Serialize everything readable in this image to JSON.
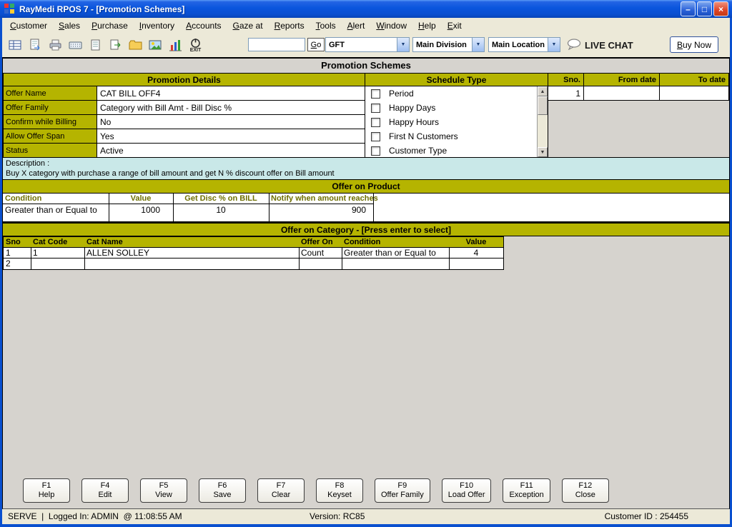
{
  "window": {
    "title": "RayMedi RPOS 7 - [Promotion Schemes]",
    "controls": {
      "minimize": "–",
      "maximize": "□",
      "close": "×"
    }
  },
  "menu": {
    "items": [
      "Customer",
      "Sales",
      "Purchase",
      "Inventory",
      "Accounts",
      "Gaze at",
      "Reports",
      "Tools",
      "Alert",
      "Window",
      "Help",
      "Exit"
    ]
  },
  "toolbar": {
    "search_value": "",
    "go_label": "Go",
    "selects": [
      "GFT",
      "Main Division",
      "Main Location"
    ],
    "live_chat_label": "LIVE CHAT",
    "buy_now_label": "Buy Now",
    "exit_caption": "EXIT"
  },
  "icons": {
    "select_arrow": "▼",
    "scroll_up": "▲",
    "scroll_down": "▼"
  },
  "page": {
    "title": "Promotion Schemes"
  },
  "promotion_details": {
    "header": "Promotion Details",
    "fields": [
      {
        "label": "Offer Name",
        "value": "CAT BILL OFF4"
      },
      {
        "label": "Offer Family",
        "value": "Category with Bill Amt - Bill Disc %"
      },
      {
        "label": "Confirm while Billing",
        "value": "No"
      },
      {
        "label": "Allow Offer Span",
        "value": "Yes"
      },
      {
        "label": "Status",
        "value": "Active"
      }
    ]
  },
  "schedule": {
    "header": "Schedule Type",
    "items": [
      "Period",
      "Happy Days",
      "Happy Hours",
      "First N Customers",
      "Customer Type"
    ],
    "table_headers": [
      "Sno.",
      "From date",
      "To date"
    ],
    "first_row_sno": "1"
  },
  "description": {
    "label": "Description :",
    "text": "Buy X category with purchase a range of bill amount and get N % discount offer on Bill amount"
  },
  "offer_on_product": {
    "header": "Offer on Product",
    "columns": [
      "Condition",
      "Value",
      "Get Disc % on BILL",
      "Notify when amount reaches"
    ],
    "rows": [
      [
        "Greater than or Equal to",
        "1000",
        "10",
        "900"
      ]
    ]
  },
  "offer_on_category": {
    "header": "Offer on Category - [Press enter to select]",
    "columns": [
      "Sno",
      "Cat Code",
      "Cat Name",
      "Offer On",
      "Condition",
      "Value"
    ],
    "rows": [
      [
        "1",
        "1",
        "ALLEN SOLLEY",
        "Count",
        "Greater than or Equal to",
        "4"
      ],
      [
        "2",
        "",
        "",
        "",
        "",
        ""
      ]
    ]
  },
  "function_keys": [
    {
      "key": "F1",
      "label": "Help"
    },
    {
      "key": "F4",
      "label": "Edit"
    },
    {
      "key": "F5",
      "label": "View"
    },
    {
      "key": "F6",
      "label": "Save"
    },
    {
      "key": "F7",
      "label": "Clear"
    },
    {
      "key": "F8",
      "label": "Keyset"
    },
    {
      "key": "F9",
      "label": "Offer Family"
    },
    {
      "key": "F10",
      "label": "Load Offer"
    },
    {
      "key": "F11",
      "label": "Exception"
    },
    {
      "key": "F12",
      "label": "Close"
    }
  ],
  "status_bar": {
    "left": "SERVE  |  Logged In: ADMIN  @ 11:08:55 AM",
    "center": "Version: RC85",
    "right": "Customer ID : 254455"
  },
  "colors": {
    "header_olive": "#b5b400",
    "description_bg": "#c9e8e8",
    "titlebar_blue": "#0a55dd"
  }
}
